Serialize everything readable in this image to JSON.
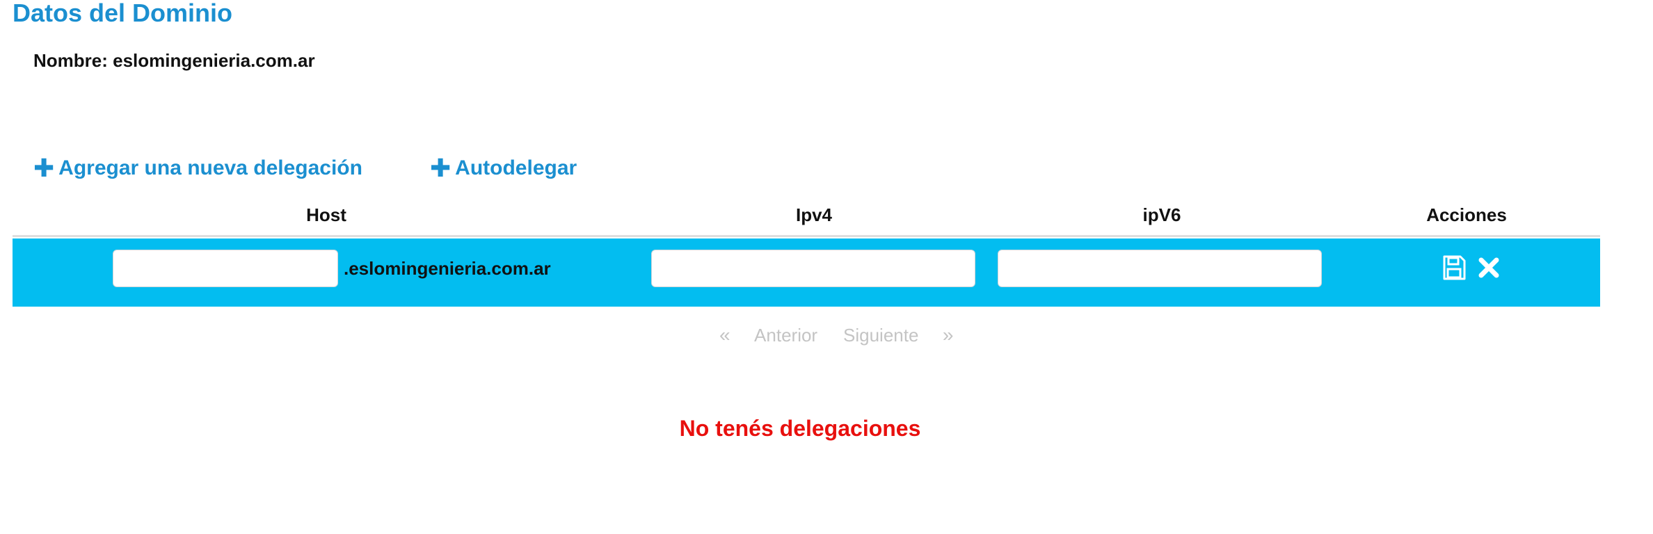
{
  "page": {
    "title": "Datos del Dominio",
    "domain_label": "Nombre: eslomingenieria.com.ar"
  },
  "actions": {
    "add_delegation": "Agregar una nueva delegación",
    "auto_delegate": "Autodelegar",
    "plus_glyph": "✚"
  },
  "table": {
    "headers": {
      "host": "Host",
      "ipv4": "Ipv4",
      "ipv6": "ipV6",
      "actions": "Acciones"
    },
    "edit_row": {
      "host_value": "",
      "domain_suffix": ".eslomingenieria.com.ar",
      "ipv4_value": "",
      "ipv6_value": "",
      "row_color": "#03bdf0"
    }
  },
  "pagination": {
    "prev_arrow": "«",
    "prev_label": "Anterior",
    "next_label": "Siguiente",
    "next_arrow": "»"
  },
  "empty_message": "No tenés delegaciones",
  "colors": {
    "accent": "#1b8fd0",
    "error": "#e8100e",
    "disabled": "#c4c4c4"
  }
}
